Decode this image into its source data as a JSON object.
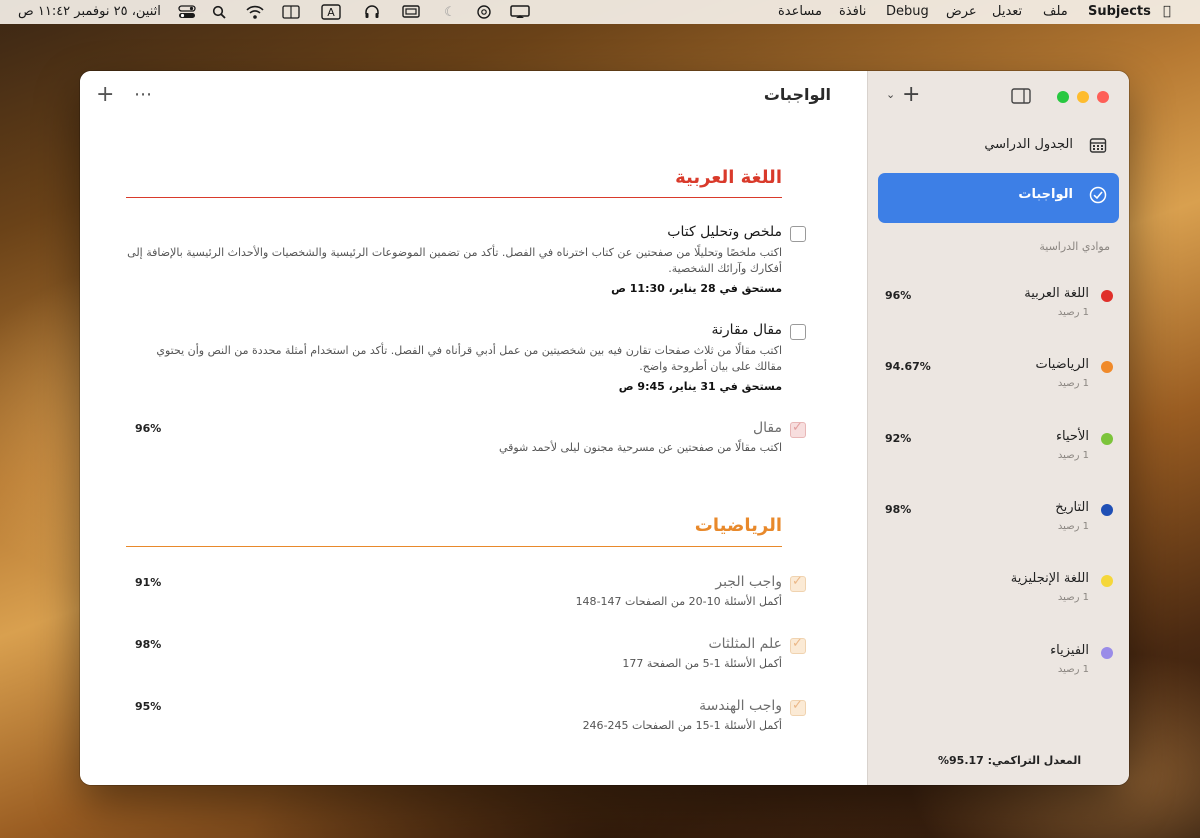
{
  "menubar": {
    "app_name": "Subjects",
    "menus": [
      "ملف",
      "تعديل",
      "عرض",
      "Debug",
      "نافذة",
      "مساعدة"
    ],
    "clock": "اثنين، ٢٥ نوفمبر ١١:٤٢ ص"
  },
  "window": {
    "title": "الواجبات"
  },
  "sections": [
    {
      "title": "اللغة العربية",
      "color": "#d93a2b",
      "tasks": [
        {
          "title": "ملخص وتحليل كتاب",
          "description": "اكتب ملخصًا وتحليلًا من صفحتين عن كتاب اخترناه في الفصل. تأكد من تضمين الموضوعات الرئيسية والشخصيات والأحداث الرئيسية بالإضافة إلى أفكارك وآرائك الشخصية.",
          "due": "مستحق في 28 يناير، 11:30 ص",
          "completed": false
        },
        {
          "title": "مقال مقارنة",
          "description": "اكتب مقالًا من ثلاث صفحات تقارن فيه بين شخصيتين من عمل أدبي قرأناه في الفصل. تأكد من استخدام أمثلة محددة من النص وأن يحتوي مقالك على بيان أطروحة واضح.",
          "due": "مستحق في 31 يناير، 9:45 ص",
          "completed": false
        },
        {
          "title": "مقال",
          "description": "اكتب مقالًا من صفحتين عن مسرحية مجنون ليلى لأحمد شوقي",
          "grade": "96%",
          "completed": true
        }
      ]
    },
    {
      "title": "الرياضيات",
      "color": "#e8892b",
      "tasks": [
        {
          "title": "واجب الجبر",
          "description": "أكمل الأسئلة 10-20 من الصفحات 147-148",
          "grade": "91%",
          "completed": true
        },
        {
          "title": "علم المثلثات",
          "description": "أكمل الأسئلة 1-5 من الصفحة 177",
          "grade": "98%",
          "completed": true
        },
        {
          "title": "واجب الهندسة",
          "description": "أكمل الأسئلة 1-15 من الصفحات 245-246",
          "grade": "95%",
          "completed": true
        }
      ]
    }
  ],
  "sidebar": {
    "nav": [
      {
        "label": "الجدول الدراسي",
        "icon": "calendar-icon",
        "active": false
      },
      {
        "label": "الواجبات",
        "icon": "checkmark-circle-icon",
        "active": true
      }
    ],
    "subjects_header": "موادي الدراسية",
    "subjects": [
      {
        "name": "اللغة العربية",
        "count": "1 رصيد",
        "grade": "96%",
        "color": "#e0302a"
      },
      {
        "name": "الرياضيات",
        "count": "1 رصيد",
        "grade": "94.67%",
        "color": "#f08a2a"
      },
      {
        "name": "الأحياء",
        "count": "1 رصيد",
        "grade": "92%",
        "color": "#7cc43a"
      },
      {
        "name": "التاريخ",
        "count": "1 رصيد",
        "grade": "98%",
        "color": "#1f4fb5"
      },
      {
        "name": "اللغة الإنجليزية",
        "count": "1 رصيد",
        "grade": "",
        "color": "#f5d73a"
      },
      {
        "name": "الفيزياء",
        "count": "1 رصيد",
        "grade": "",
        "color": "#9a8ce8"
      }
    ],
    "footer": "المعدل التراكمي: 95.17%"
  },
  "colors": {
    "accent": "#3d7fe6",
    "traffic_close": "#fe5f57",
    "traffic_min": "#febc2e",
    "traffic_max": "#28c840"
  }
}
